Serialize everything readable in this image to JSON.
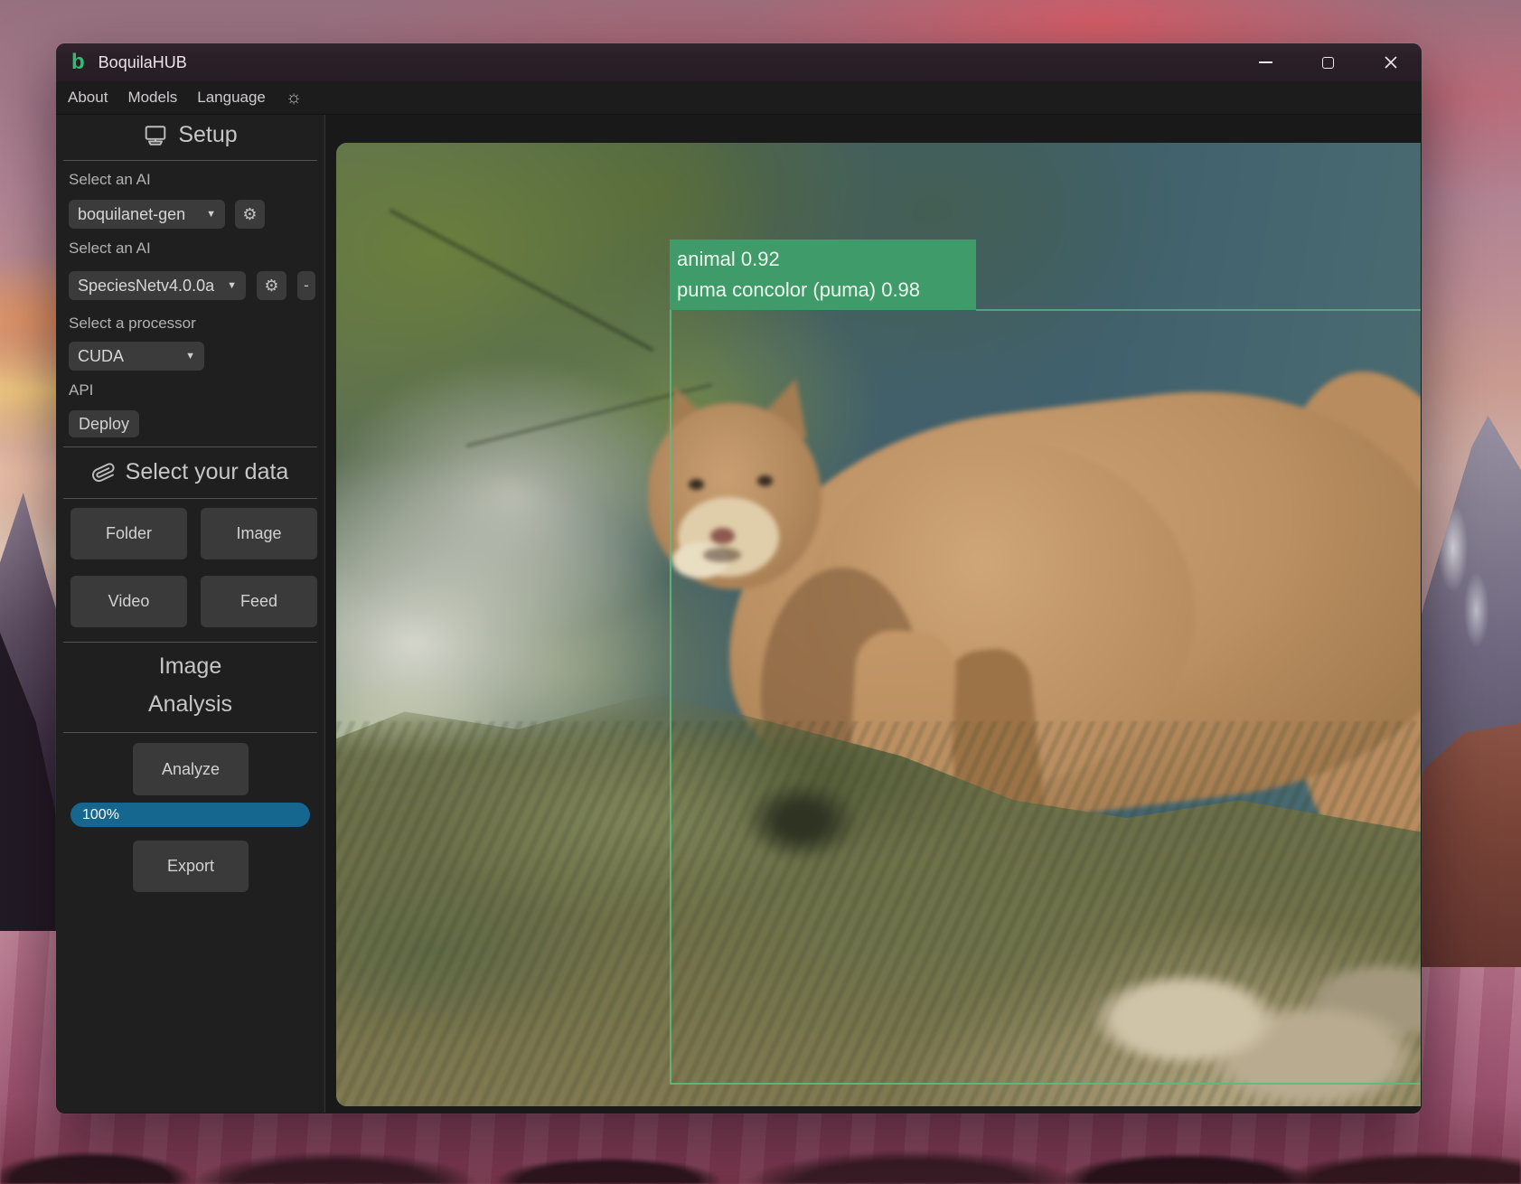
{
  "window": {
    "title": "BoquilaHUB",
    "logo_letter": "b"
  },
  "menu": {
    "items": [
      "About",
      "Models",
      "Language"
    ]
  },
  "icons": {
    "theme": "☼",
    "gear": "⚙",
    "dropdown_arrow": "▼",
    "minus": "-",
    "setup": "monitor-icon",
    "data": "paperclip-icon",
    "window_controls": [
      "minimize",
      "maximize",
      "close"
    ]
  },
  "sidebar": {
    "setup_title": "Setup",
    "ai1": {
      "label": "Select an AI",
      "value": "boquilanet-gen"
    },
    "ai2": {
      "label": "Select an AI",
      "value": "SpeciesNetv4.0.0a"
    },
    "processor": {
      "label": "Select a processor",
      "value": "CUDA"
    },
    "api_label": "API",
    "deploy_label": "Deploy",
    "data_title": "Select your data",
    "data_buttons": [
      "Folder",
      "Image",
      "Video",
      "Feed"
    ],
    "analysis_title": [
      "Image",
      "Analysis"
    ],
    "analyze_label": "Analyze",
    "progress": {
      "text": "100%",
      "value": 100
    },
    "export_label": "Export"
  },
  "detection": {
    "lines": [
      "animal 0.92",
      "puma concolor (puma) 0.98"
    ],
    "label_color": "#3f9c6a",
    "box_color": "#5cb980"
  },
  "colors": {
    "accent_green": "#2fbf71",
    "progress_blue": "#15678f",
    "titlebar": "#2a1f26",
    "sidebar_bg": "#1f1f1f",
    "button_bg": "#3b3b3b"
  }
}
